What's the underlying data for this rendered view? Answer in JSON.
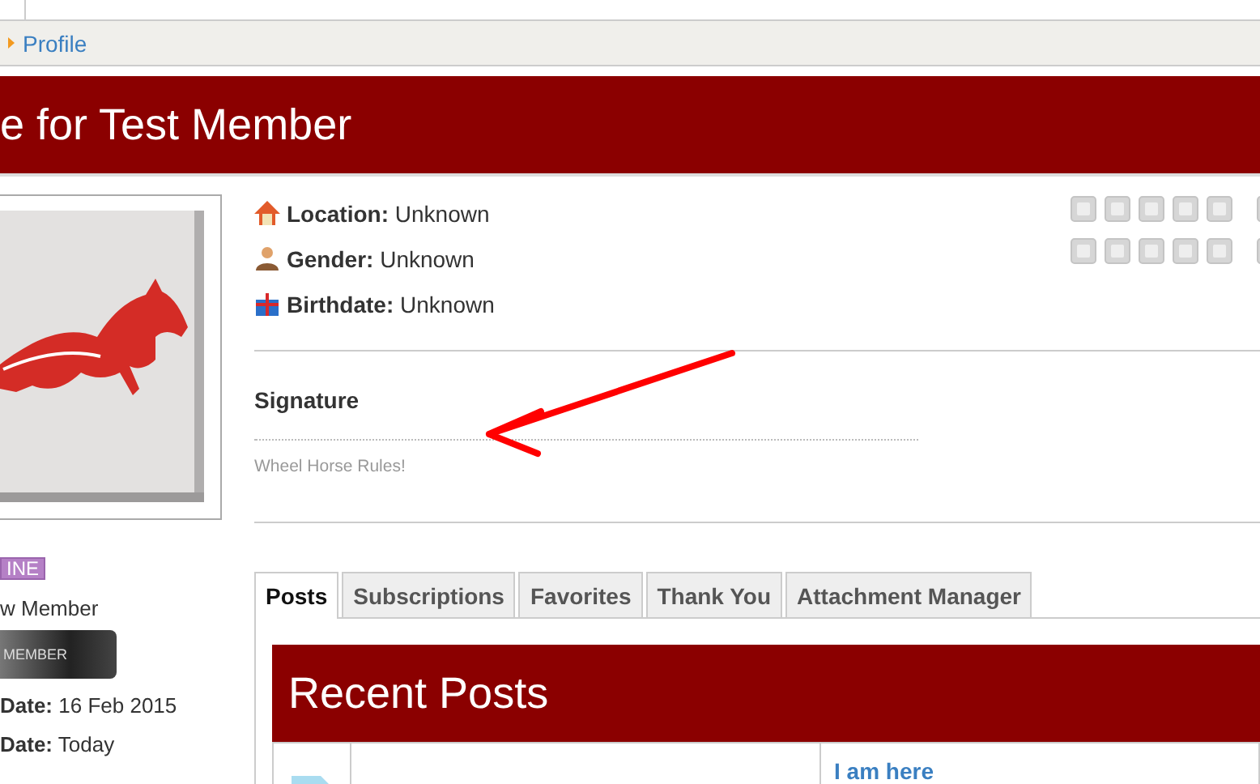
{
  "breadcrumb": {
    "label": "Profile"
  },
  "title": "e for Test Member",
  "sidebar": {
    "status_badge": "INE",
    "rank_title": "w Member",
    "rank_badge": "MEMBER",
    "stats": [
      {
        "label": "Date:",
        "value": "16 Feb 2015"
      },
      {
        "label": "Date:",
        "value": "Today"
      }
    ]
  },
  "details": [
    {
      "kind": "location",
      "label": "Location:",
      "value": "Unknown"
    },
    {
      "kind": "gender",
      "label": "Gender:",
      "value": "Unknown"
    },
    {
      "kind": "birthdate",
      "label": "Birthdate:",
      "value": "Unknown"
    }
  ],
  "signature": {
    "heading": "Signature",
    "text": "Wheel Horse Rules!"
  },
  "tabs": [
    {
      "label": "Posts",
      "selected": true
    },
    {
      "label": "Subscriptions",
      "selected": false
    },
    {
      "label": "Favorites",
      "selected": false
    },
    {
      "label": "Thank You",
      "selected": false
    },
    {
      "label": "Attachment Manager",
      "selected": false
    }
  ],
  "recent_posts": {
    "title": "Recent Posts",
    "link": "I am here"
  }
}
